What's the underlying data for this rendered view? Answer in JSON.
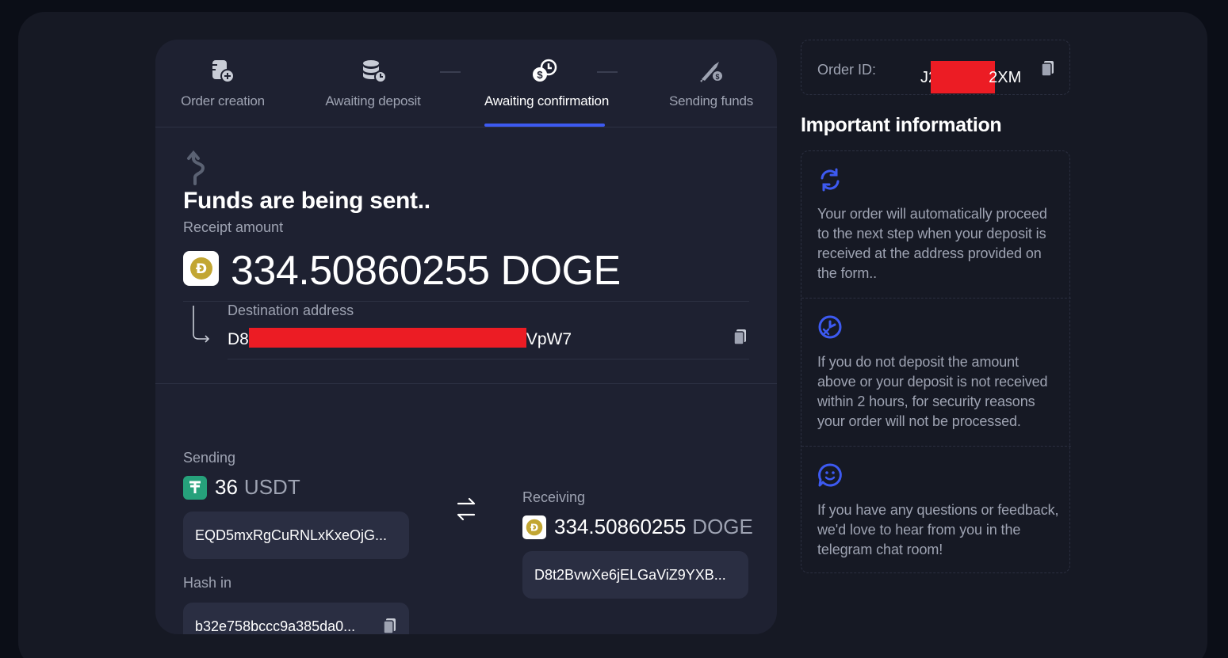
{
  "steps": [
    {
      "label": "Order creation",
      "icon": "order-creation-icon"
    },
    {
      "label": "Awaiting deposit",
      "icon": "coins-clock-icon"
    },
    {
      "label": "Awaiting confirmation",
      "icon": "dollar-clock-icon",
      "active": true
    },
    {
      "label": "Sending funds",
      "icon": "rocket-dollar-icon"
    }
  ],
  "status": {
    "title": "Funds are being sent..",
    "receipt_label": "Receipt amount",
    "amount": "334.50860255 DOGE",
    "destination_label": "Destination address",
    "destination_prefix": "D8",
    "destination_suffix": "VpW7"
  },
  "sending": {
    "label": "Sending",
    "amount": "36",
    "currency": "USDT",
    "address": "EQD5mxRgCuRNLxKxeOjG...",
    "hash_label": "Hash in",
    "hash": "b32e758bccc9a385da0..."
  },
  "receiving": {
    "label": "Receiving",
    "amount": "334.50860255",
    "currency": "DOGE",
    "address": "D8t2BvwXe6jELGaViZ9YXB..."
  },
  "order": {
    "label": "Order ID:",
    "prefix": "J2",
    "suffix": "2XM"
  },
  "info": {
    "title": "Important information",
    "items": [
      "Your order will automatically proceed to the next step when your deposit is received at the address provided on the form..",
      "If you do not deposit the amount above or your deposit is not received within 2 hours, for security reasons your order will not be processed.",
      "If you have any questions or feedback, we'd love to hear from you in the telegram chat room!"
    ]
  },
  "colors": {
    "accent": "#3d5af1",
    "doge": "#c2a633",
    "tether": "#26a17b",
    "redaction": "#ec1c24"
  }
}
